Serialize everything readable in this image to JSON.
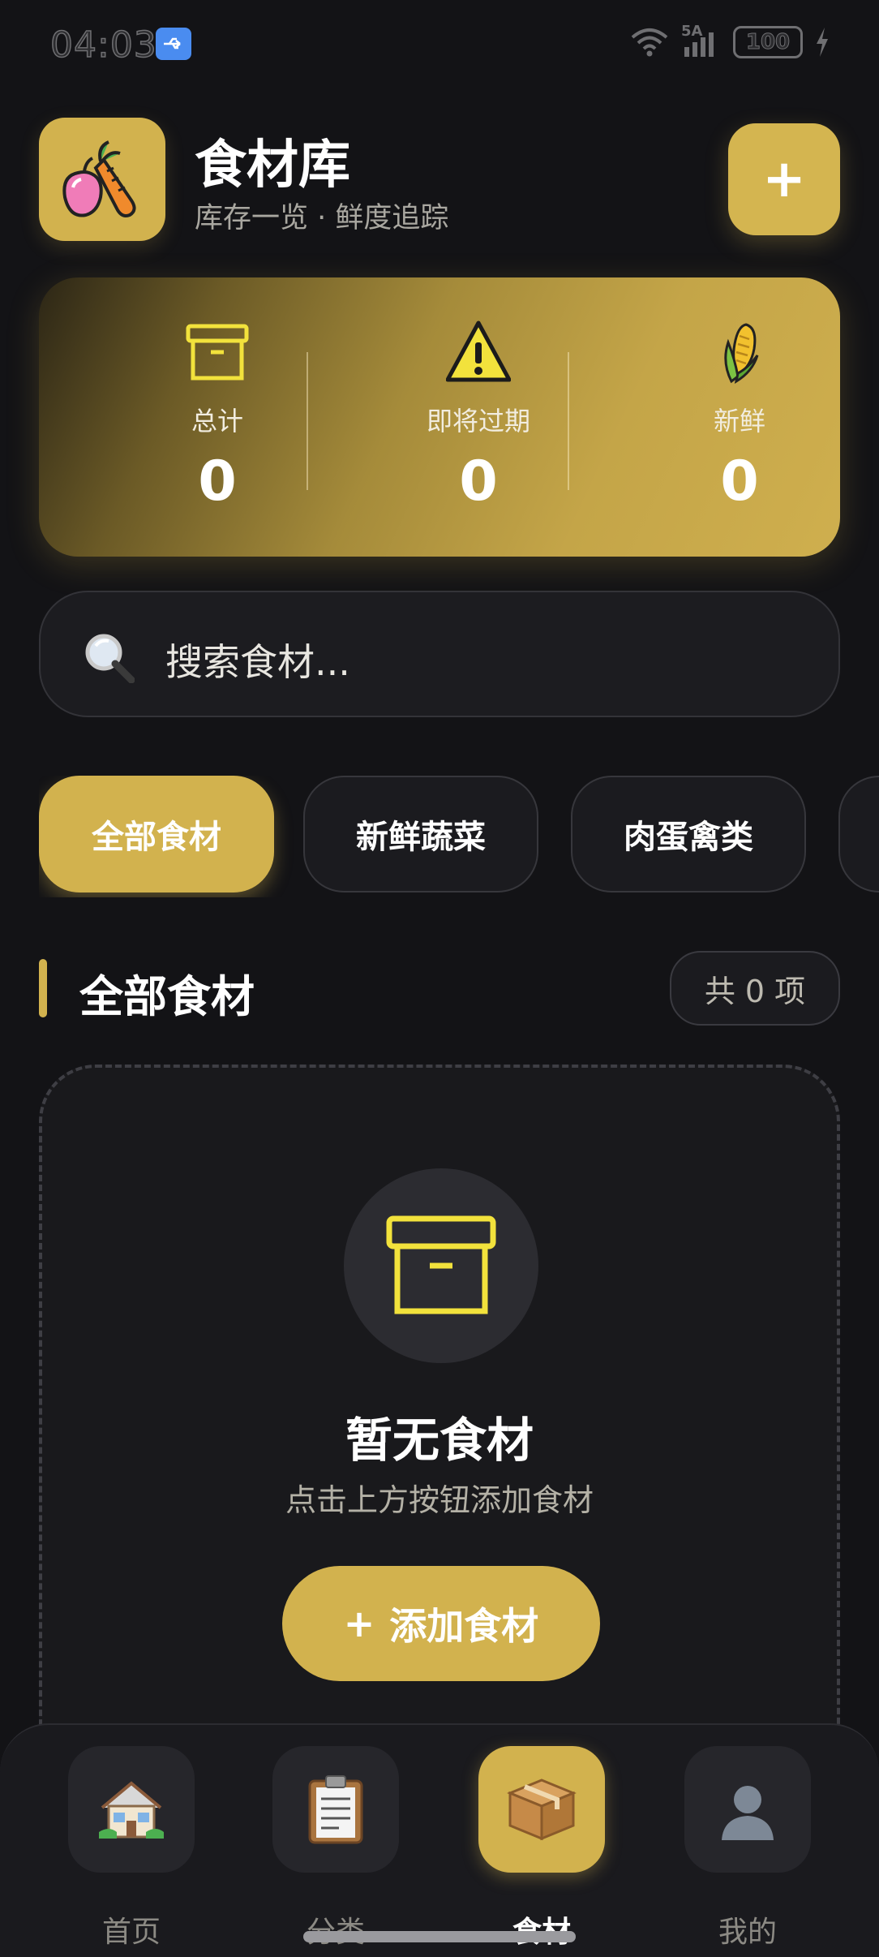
{
  "status_bar": {
    "time": "04:03",
    "network": "5A",
    "battery": "100"
  },
  "header": {
    "title": "食材库",
    "subtitle": "库存一览 · 鲜度追踪",
    "add_label": "+"
  },
  "stats": [
    {
      "label": "总计",
      "value": "0",
      "icon": "box-icon"
    },
    {
      "label": "即将过期",
      "value": "0",
      "icon": "warning-icon"
    },
    {
      "label": "新鲜",
      "value": "0",
      "icon": "corn-icon"
    }
  ],
  "search": {
    "placeholder": "搜索食材..."
  },
  "categories": [
    {
      "label": "全部食材",
      "active": true
    },
    {
      "label": "新鲜蔬菜",
      "active": false
    },
    {
      "label": "肉蛋禽类",
      "active": false
    },
    {
      "label": "",
      "active": false
    }
  ],
  "section": {
    "title": "全部食材",
    "count": "共 0 项"
  },
  "empty_state": {
    "title": "暂无食材",
    "subtitle": "点击上方按钮添加食材",
    "button_icon": "+",
    "button_label": "添加食材"
  },
  "nav": [
    {
      "label": "首页",
      "icon": "house-icon",
      "active": false
    },
    {
      "label": "分类",
      "icon": "clipboard-icon",
      "active": false
    },
    {
      "label": "食材",
      "icon": "package-icon",
      "active": true
    },
    {
      "label": "我的",
      "icon": "user-icon",
      "active": false
    }
  ],
  "colors": {
    "accent": "#d2b24e",
    "background": "#131316",
    "card": "#1b1b1f",
    "icon_yellow": "#f2e23c"
  }
}
